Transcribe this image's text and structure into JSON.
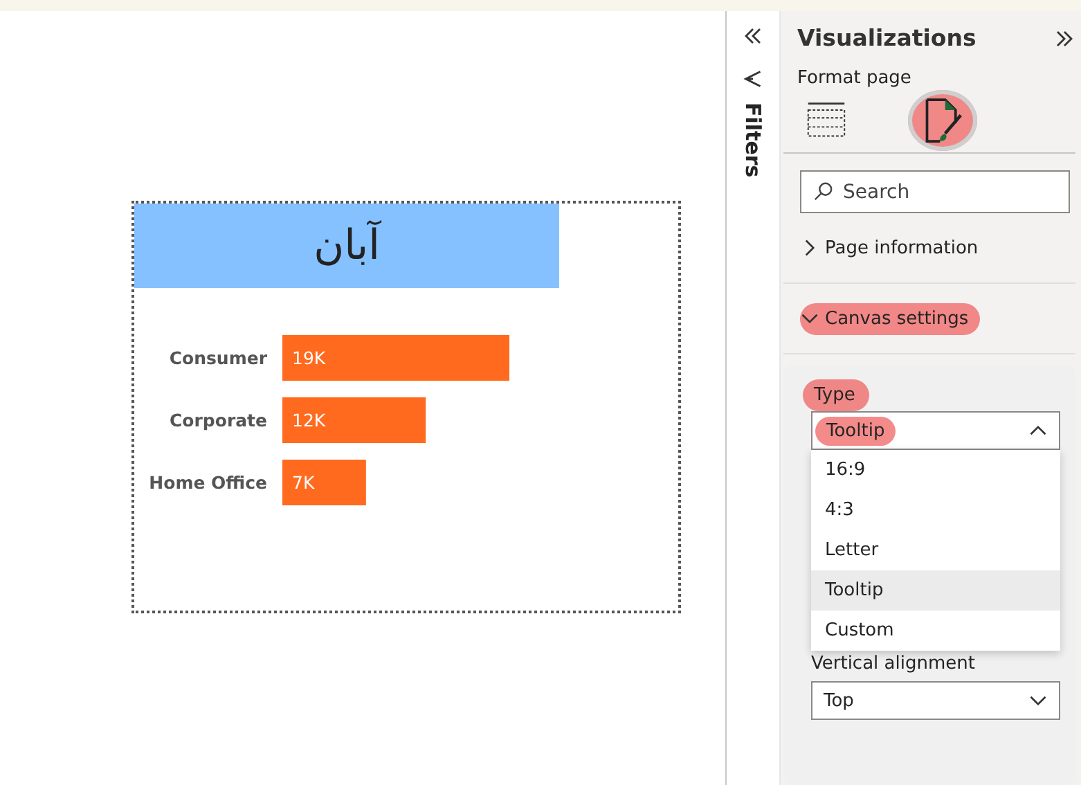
{
  "canvas": {
    "visual": {
      "title": "آبان",
      "chart_data": {
        "type": "bar",
        "orientation": "horizontal",
        "categories": [
          "Consumer",
          "Corporate",
          "Home Office"
        ],
        "values": [
          19000,
          12000,
          7000
        ],
        "value_labels": [
          "19K",
          "12K",
          "7K"
        ]
      }
    }
  },
  "filters_pane": {
    "title": "Filters"
  },
  "visualizations_pane": {
    "title": "Visualizations",
    "subtitle": "Format page",
    "format_tabs": [
      {
        "kind": "grid",
        "selected": false,
        "highlighted": false
      },
      {
        "kind": "brush",
        "selected": true,
        "highlighted": true
      }
    ],
    "search": {
      "placeholder": "Search"
    },
    "sections": [
      {
        "label": "Page information",
        "expanded": false,
        "highlighted": false
      },
      {
        "label": "Canvas settings",
        "expanded": true,
        "highlighted": true
      }
    ],
    "type_field": {
      "label": "Type",
      "label_highlighted": true,
      "value": "Tooltip",
      "value_highlighted": true,
      "open": true,
      "options": [
        {
          "label": "16:9",
          "selected": false
        },
        {
          "label": "4:3",
          "selected": false
        },
        {
          "label": "Letter",
          "selected": false
        },
        {
          "label": "Tooltip",
          "selected": true
        },
        {
          "label": "Custom",
          "selected": false
        }
      ]
    },
    "vertical_alignment": {
      "label": "Vertical alignment",
      "value": "Top"
    }
  }
}
